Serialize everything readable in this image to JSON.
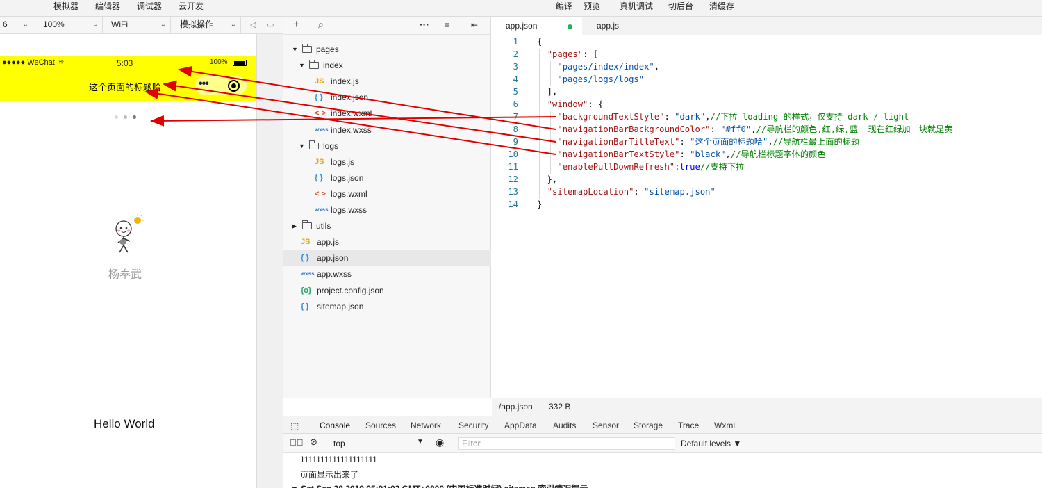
{
  "topbar": {
    "left_menu": [
      "模拟器",
      "编辑器",
      "调试器",
      "云开发"
    ],
    "right_menu": [
      "编译",
      "预览",
      "真机调试",
      "切后台",
      "清缓存"
    ]
  },
  "sim_toolbar": {
    "device": "6",
    "zoom": "100%",
    "network": "WiFi",
    "mode": "模拟操作"
  },
  "phone": {
    "status_left": "●●●●● WeChat",
    "time": "5:03",
    "battery": "100%",
    "nav_title": "这个页面的标题哈",
    "nav_bg": "#ffff00",
    "username": "杨奉武",
    "hello": "Hello World"
  },
  "tree": {
    "items": [
      {
        "label": "pages",
        "type": "folder",
        "depth": 0,
        "open": true
      },
      {
        "label": "index",
        "type": "folder",
        "depth": 1,
        "open": true
      },
      {
        "label": "index.js",
        "type": "js",
        "depth": 2
      },
      {
        "label": "index.json",
        "type": "json",
        "depth": 2
      },
      {
        "label": "index.wxml",
        "type": "wxml",
        "depth": 2
      },
      {
        "label": "index.wxss",
        "type": "wxss",
        "depth": 2
      },
      {
        "label": "logs",
        "type": "folder",
        "depth": 1,
        "open": true
      },
      {
        "label": "logs.js",
        "type": "js",
        "depth": 2
      },
      {
        "label": "logs.json",
        "type": "json",
        "depth": 2
      },
      {
        "label": "logs.wxml",
        "type": "wxml",
        "depth": 2
      },
      {
        "label": "logs.wxss",
        "type": "wxss",
        "depth": 2
      },
      {
        "label": "utils",
        "type": "folder",
        "depth": 0,
        "open": false
      },
      {
        "label": "app.js",
        "type": "js",
        "depth": 0
      },
      {
        "label": "app.json",
        "type": "json",
        "depth": 0,
        "selected": true
      },
      {
        "label": "app.wxss",
        "type": "wxss",
        "depth": 0
      },
      {
        "label": "project.config.json",
        "type": "config",
        "depth": 0
      },
      {
        "label": "sitemap.json",
        "type": "json",
        "depth": 0
      }
    ],
    "icon_text": {
      "js": "JS",
      "json": "{ }",
      "wxml": "< >",
      "wxss": "wxss",
      "config": "{o}"
    }
  },
  "editor": {
    "tabs": [
      {
        "label": "app.json",
        "active": true
      },
      {
        "label": "app.js",
        "active": false
      }
    ],
    "lines": [
      "{",
      "  \"pages\": [",
      "    \"pages/index/index\",",
      "    \"pages/logs/logs\"",
      "  ],",
      "  \"window\": {",
      "    \"backgroundTextStyle\": \"dark\",//下拉 loading 的样式，仅支持 dark / light",
      "    \"navigationBarBackgroundColor\": \"#ff0\",//导航栏的颜色,红,绿,蓝  现在红绿加一块就是黄",
      "    \"navigationBarTitleText\": \"这个页面的标题哈\",//导航栏最上面的标题",
      "    \"navigationBarTextStyle\": \"black\",//导航栏标题字体的颜色",
      "    \"enablePullDownRefresh\":true//支持下拉",
      "  },",
      "  \"sitemapLocation\": \"sitemap.json\"",
      "}"
    ],
    "status_path": "/app.json",
    "status_size": "332 B"
  },
  "devtools": {
    "tabs": [
      "Console",
      "Sources",
      "Network",
      "Security",
      "AppData",
      "Audits",
      "Sensor",
      "Storage",
      "Trace",
      "Wxml"
    ],
    "context": "top",
    "filter_placeholder": "Filter",
    "levels": "Default levels ▼",
    "logs": [
      "1111111111111111111",
      "页面显示出来了",
      "▼ Sat Sep 28 2019 05:01:02 GMT+0800 (中国标准时间) sitemap 索引情况提示"
    ]
  },
  "colors": {
    "annotation_arrow": "#e00000",
    "accent": "#1a73e8",
    "modified_dot": "#21b45c"
  }
}
